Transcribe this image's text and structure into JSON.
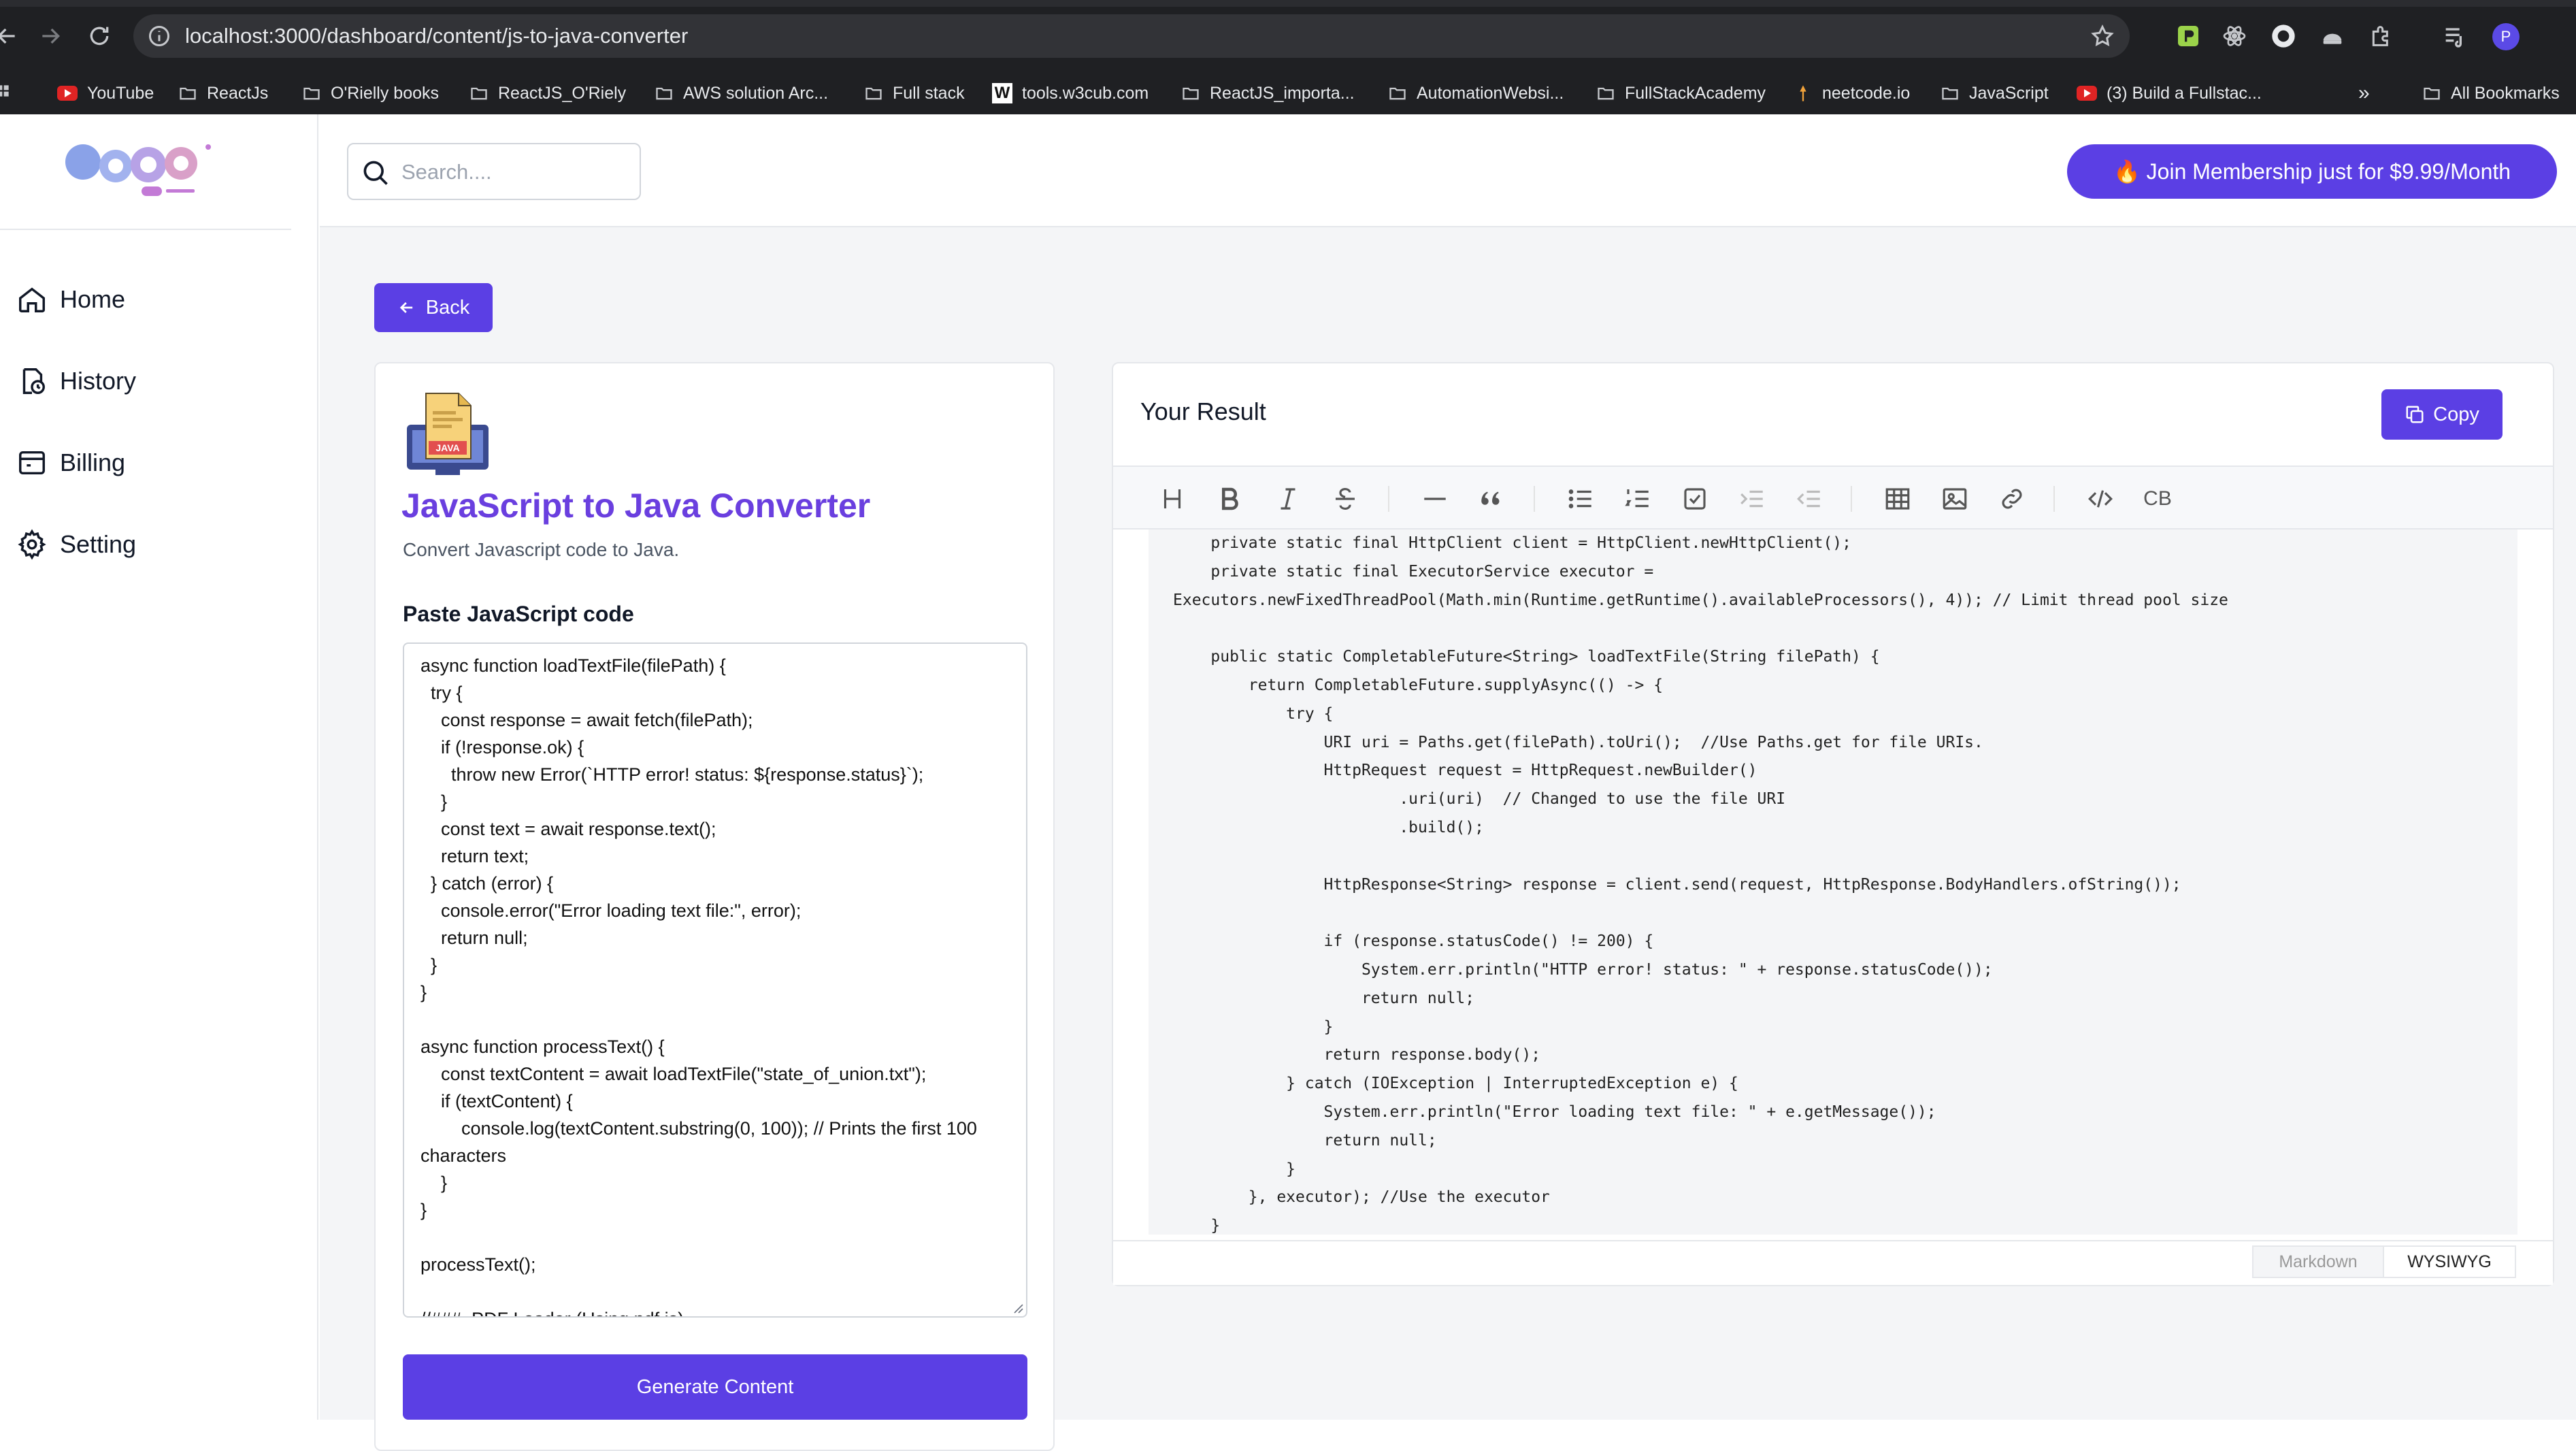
{
  "browser": {
    "url": "localhost:3000/dashboard/content/js-to-java-converter",
    "bookmarks": [
      {
        "label": "YouTube",
        "icon": "youtube-icon"
      },
      {
        "label": "ReactJs",
        "icon": "folder-icon"
      },
      {
        "label": "O'Rielly books",
        "icon": "folder-icon"
      },
      {
        "label": "ReactJS_O'Riely",
        "icon": "folder-icon"
      },
      {
        "label": "AWS solution Arc...",
        "icon": "folder-icon"
      },
      {
        "label": "Full stack",
        "icon": "folder-icon"
      },
      {
        "label": "tools.w3cub.com",
        "icon": "w3cub-icon"
      },
      {
        "label": "ReactJS_importa...",
        "icon": "folder-icon"
      },
      {
        "label": "AutomationWebsi...",
        "icon": "folder-icon"
      },
      {
        "label": "FullStackAcademy",
        "icon": "folder-icon"
      },
      {
        "label": "neetcode.io",
        "icon": "neetcode-icon"
      },
      {
        "label": "JavaScript",
        "icon": "folder-icon"
      },
      {
        "label": "(3) Build a Fullstac...",
        "icon": "youtube-icon"
      }
    ],
    "more_bookmarks": "»",
    "all_bookmarks": "All Bookmarks",
    "profile_initial": "P"
  },
  "sidebar": {
    "items": [
      {
        "label": "Home",
        "icon": "home-icon"
      },
      {
        "label": "History",
        "icon": "history-icon"
      },
      {
        "label": "Billing",
        "icon": "billing-icon"
      },
      {
        "label": "Setting",
        "icon": "gear-icon"
      }
    ]
  },
  "header": {
    "search_placeholder": "Search....",
    "membership_label": "🔥 Join Membership just for $9.99/Month"
  },
  "back_label": "Back",
  "tool": {
    "title": "JavaScript to Java Converter",
    "description": "Convert Javascript code to Java.",
    "input_label": "Paste JavaScript code",
    "input_value": "async function loadTextFile(filePath) {\n  try {\n    const response = await fetch(filePath);\n    if (!response.ok) {\n      throw new Error(`HTTP error! status: ${response.status}`);\n    }\n    const text = await response.text();\n    return text;\n  } catch (error) {\n    console.error(\"Error loading text file:\", error);\n    return null;\n  }\n}\n\nasync function processText() {\n    const textContent = await loadTextFile(\"state_of_union.txt\");\n    if (textContent) {\n        console.log(textContent.substring(0, 100)); // Prints the first 100 characters\n    }\n}\n\nprocessText();\n\n//###  PDF Loader (Using pdf.js)",
    "generate_label": "Generate Content"
  },
  "result": {
    "title": "Your Result",
    "copy_label": "Copy",
    "toolbar": [
      {
        "name": "heading-icon"
      },
      {
        "name": "bold-icon"
      },
      {
        "name": "italic-icon"
      },
      {
        "name": "strikethrough-icon"
      },
      {
        "name": "horizontal-rule-icon"
      },
      {
        "name": "blockquote-icon"
      },
      {
        "name": "bullet-list-icon"
      },
      {
        "name": "ordered-list-icon"
      },
      {
        "name": "task-list-icon"
      },
      {
        "name": "indent-icon"
      },
      {
        "name": "outdent-icon"
      },
      {
        "name": "table-icon"
      },
      {
        "name": "image-icon"
      },
      {
        "name": "link-icon"
      },
      {
        "name": "code-icon"
      },
      {
        "name": "code-block-icon",
        "text": "CB"
      }
    ],
    "code": "    private static final HttpClient client = HttpClient.newHttpClient();\n    private static final ExecutorService executor =\nExecutors.newFixedThreadPool(Math.min(Runtime.getRuntime().availableProcessors(), 4)); // Limit thread pool size\n\n    public static CompletableFuture<String> loadTextFile(String filePath) {\n        return CompletableFuture.supplyAsync(() -> {\n            try {\n                URI uri = Paths.get(filePath).toUri();  //Use Paths.get for file URIs.\n                HttpRequest request = HttpRequest.newBuilder()\n                        .uri(uri)  // Changed to use the file URI\n                        .build();\n\n                HttpResponse<String> response = client.send(request, HttpResponse.BodyHandlers.ofString());\n\n                if (response.statusCode() != 200) {\n                    System.err.println(\"HTTP error! status: \" + response.statusCode());\n                    return null;\n                }\n                return response.body();\n            } catch (IOException | InterruptedException e) {\n                System.err.println(\"Error loading text file: \" + e.getMessage());\n                return null;\n            }\n        }, executor); //Use the executor\n    }",
    "mode_markdown": "Markdown",
    "mode_wysiwyg": "WYSIWYG"
  },
  "colors": {
    "accent": "#5b3fe4",
    "title": "#6a3fdf",
    "chrome": "#1f2023"
  }
}
